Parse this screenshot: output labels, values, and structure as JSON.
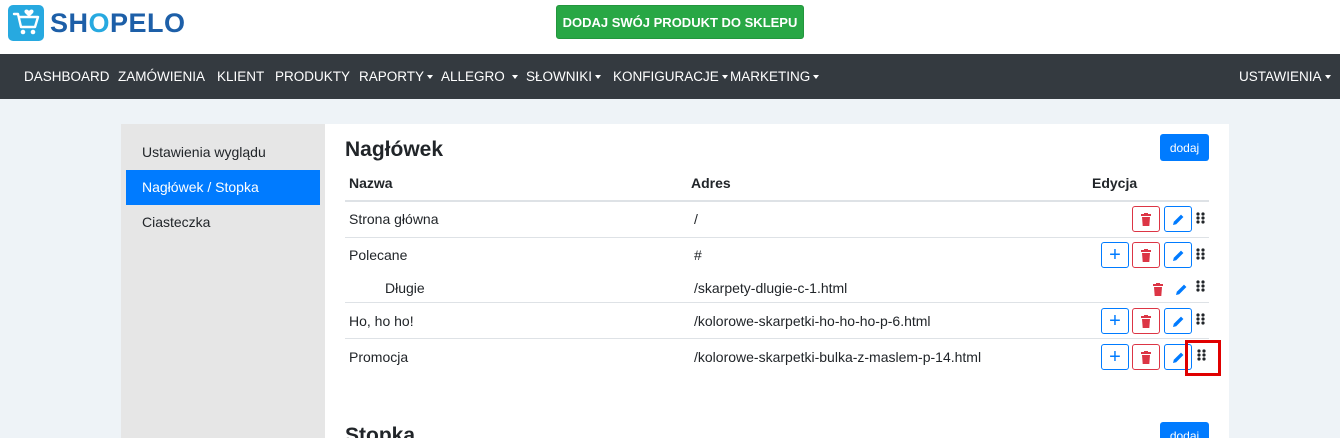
{
  "brand": {
    "name_prefix": "SH",
    "name_o": "O",
    "name_suffix": "PELO",
    "color": "#1d5fa8",
    "accent": "#27a9e0"
  },
  "header": {
    "cta_label": "DODAJ SWÓJ PRODUKT DO SKLEPU"
  },
  "nav": {
    "items": [
      {
        "label": "DASHBOARD"
      },
      {
        "label": "ZAMÓWIENIA"
      },
      {
        "label": "KLIENT"
      },
      {
        "label": "PRODUKTY"
      },
      {
        "label": "RAPORTY",
        "dropdown": true
      },
      {
        "label": "ALLEGRO",
        "dropdown": true
      },
      {
        "label": "SŁOWNIKI",
        "dropdown": true
      },
      {
        "label": "KONFIGURACJE",
        "dropdown": true
      },
      {
        "label": "MARKETING",
        "dropdown": true
      }
    ],
    "settings_label": "USTAWIENIA"
  },
  "sidebar": {
    "items": [
      {
        "label": "Ustawienia wyglądu"
      },
      {
        "label": "Nagłówek / Stopka",
        "active": true
      },
      {
        "label": "Ciasteczka"
      }
    ]
  },
  "header_section": {
    "title": "Nagłówek",
    "add_label": "dodaj",
    "columns": {
      "name": "Nazwa",
      "address": "Adres",
      "edit": "Edycja"
    },
    "rows": [
      {
        "name": "Strona główna",
        "address": "/",
        "level": 0,
        "actions": [
          "delete",
          "edit",
          "move"
        ]
      },
      {
        "name": "Polecane",
        "address": "#",
        "level": 0,
        "actions": [
          "add",
          "delete",
          "edit",
          "move"
        ]
      },
      {
        "name": "Długie",
        "address": "/skarpety-dlugie-c-1.html",
        "level": 1,
        "actions": [
          "delete",
          "edit",
          "move"
        ]
      },
      {
        "name": "Ho, ho ho!",
        "address": "/kolorowe-skarpetki-ho-ho-ho-p-6.html",
        "level": 0,
        "actions": [
          "add",
          "delete",
          "edit",
          "move"
        ]
      },
      {
        "name": "Promocja",
        "address": "/kolorowe-skarpetki-bulka-z-maslem-p-14.html",
        "level": 0,
        "actions": [
          "add",
          "delete",
          "edit",
          "move"
        ]
      }
    ]
  },
  "footer_section": {
    "title": "Stopka",
    "add_label": "dodaj"
  },
  "colors": {
    "primary": "#007bff",
    "danger": "#dc3545",
    "success": "#28a745",
    "navbar": "#343a40",
    "highlight": "#e00000"
  }
}
